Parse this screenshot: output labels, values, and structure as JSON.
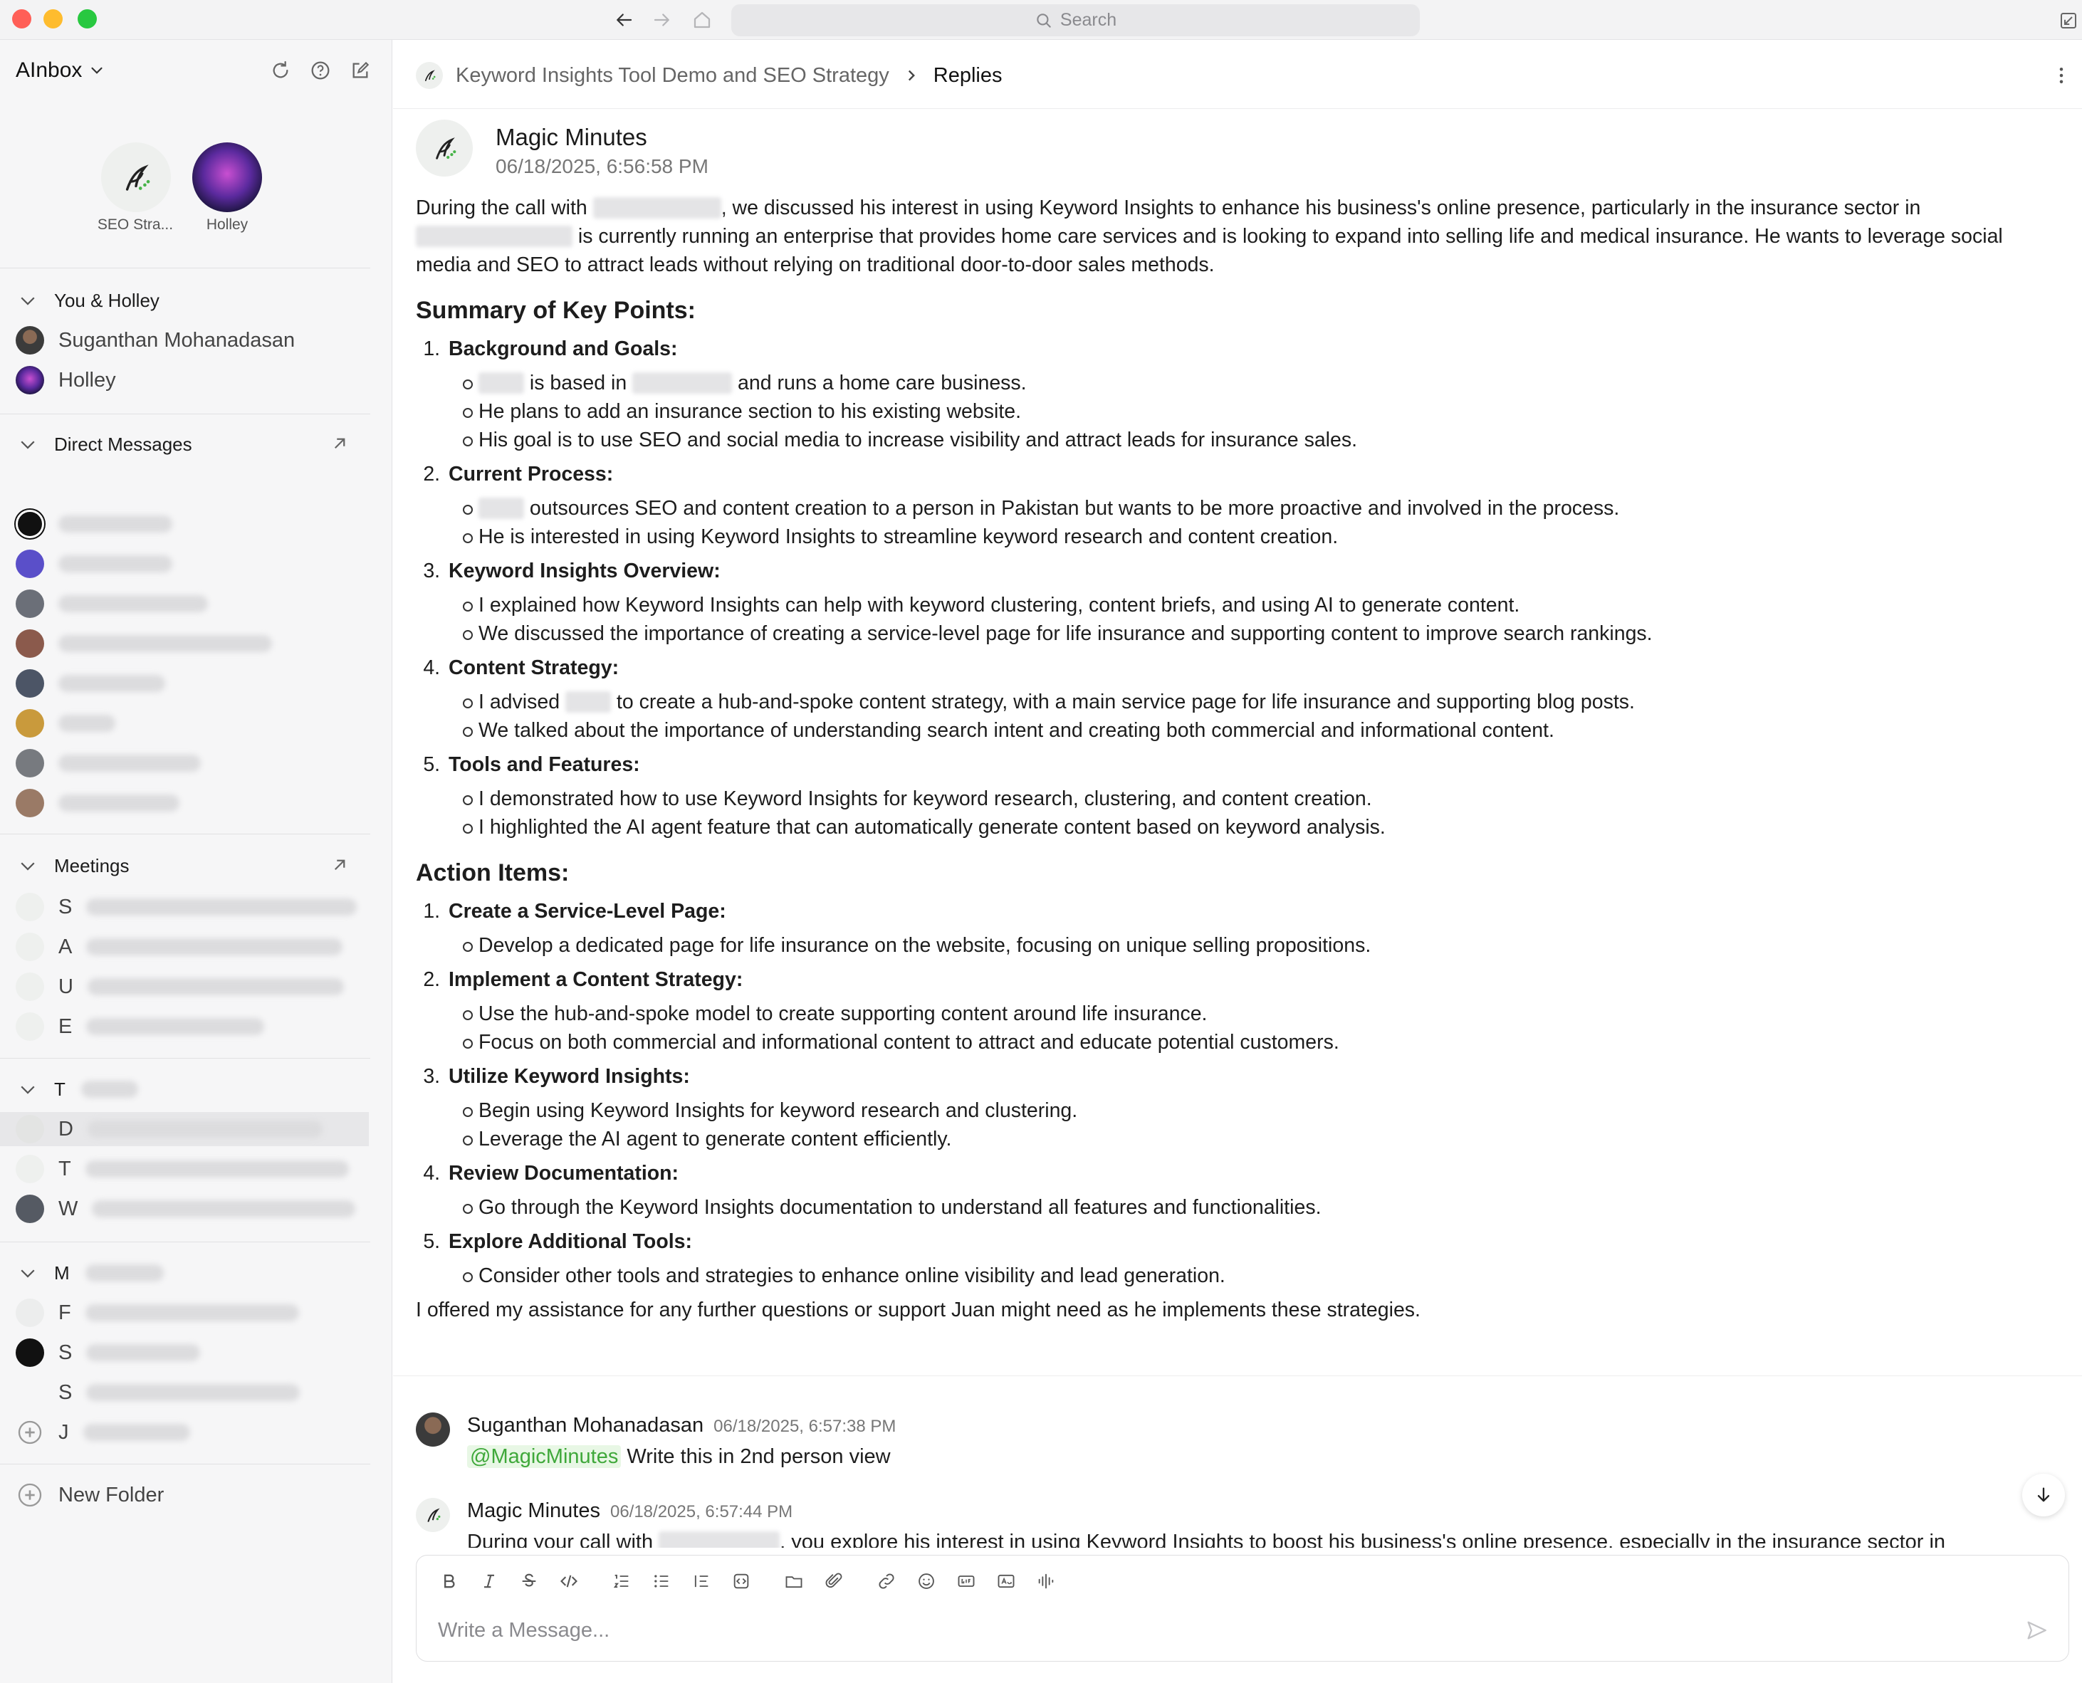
{
  "titlebar": {
    "search_placeholder": "Search"
  },
  "sidebar": {
    "title": "AInbox",
    "pinned": [
      {
        "label": "SEO Stra...",
        "color": "#eef0ee"
      },
      {
        "label": "Holley",
        "color": "#2a1a5e"
      }
    ],
    "you_holley": {
      "header": "You & Holley",
      "items": [
        "Suganthan Mohanadasan",
        "Holley"
      ]
    },
    "direct_messages": {
      "header": "Direct Messages"
    },
    "meetings": {
      "header": "Meetings",
      "items": [
        "S",
        "A",
        "U",
        "E"
      ]
    },
    "threads": {
      "header": "T",
      "items": [
        "D",
        "T",
        "W"
      ]
    },
    "more": {
      "header": "M",
      "items": [
        "F",
        "S",
        "S",
        "J"
      ]
    },
    "new_folder_label": "New Folder"
  },
  "main": {
    "breadcrumb": {
      "root": "Keyword Insights Tool Demo and SEO Strategy",
      "current": "Replies"
    },
    "post": {
      "author": "Magic Minutes",
      "date": "06/18/2025, 6:56:58 PM",
      "intro_a": "During the call with",
      "intro_b": ", we discussed his interest in using Keyword Insights to enhance his business's online presence, particularly in the insurance sector in",
      "intro_c": "is currently running an enterprise that provides home care services and is looking to expand into selling life and medical insurance. He wants to leverage social media and SEO to attract leads without relying on traditional door-to-door sales methods.",
      "summary_heading": "Summary of Key Points:",
      "summary": [
        {
          "title": "Background and Goals:",
          "bullets": [
            [
              "",
              "is based in",
              "and runs a home care business."
            ],
            [
              "He plans to add an insurance section to his existing website."
            ],
            [
              "His goal is to use SEO and social media to increase visibility and attract leads for insurance sales."
            ]
          ]
        },
        {
          "title": "Current Process:",
          "bullets": [
            [
              "",
              "outsources SEO and content creation to a person in Pakistan but wants to be more proactive and involved in the process."
            ],
            [
              "He is interested in using Keyword Insights to streamline keyword research and content creation."
            ]
          ]
        },
        {
          "title": "Keyword Insights Overview:",
          "bullets": [
            [
              "I explained how Keyword Insights can help with keyword clustering, content briefs, and using AI to generate content."
            ],
            [
              "We discussed the importance of creating a service-level page for life insurance and supporting content to improve search rankings."
            ]
          ]
        },
        {
          "title": "Content Strategy:",
          "bullets": [
            [
              "I advised",
              "to create a hub-and-spoke content strategy, with a main service page for life insurance and supporting blog posts."
            ],
            [
              "We talked about the importance of understanding search intent and creating both commercial and informational content."
            ]
          ]
        },
        {
          "title": "Tools and Features:",
          "bullets": [
            [
              "I demonstrated how to use Keyword Insights for keyword research, clustering, and content creation."
            ],
            [
              "I highlighted the AI agent feature that can automatically generate content based on keyword analysis."
            ]
          ]
        }
      ],
      "action_heading": "Action Items:",
      "actions": [
        {
          "title": "Create a Service-Level Page:",
          "bullets": [
            "Develop a dedicated page for life insurance on the website, focusing on unique selling propositions."
          ]
        },
        {
          "title": "Implement a Content Strategy:",
          "bullets": [
            "Use the hub-and-spoke model to create supporting content around life insurance.",
            "Focus on both commercial and informational content to attract and educate potential customers."
          ]
        },
        {
          "title": "Utilize Keyword Insights:",
          "bullets": [
            "Begin using Keyword Insights for keyword research and clustering.",
            "Leverage the AI agent to generate content efficiently."
          ]
        },
        {
          "title": "Review Documentation:",
          "bullets": [
            "Go through the Keyword Insights documentation to understand all features and functionalities."
          ]
        },
        {
          "title": "Explore Additional Tools:",
          "bullets": [
            "Consider other tools and strategies to enhance online visibility and lead generation."
          ]
        }
      ],
      "closing": "I offered my assistance for any further questions or support Juan might need as he implements these strategies."
    },
    "replies": [
      {
        "author": "Suganthan Mohanadasan",
        "time": "06/18/2025, 6:57:38 PM",
        "mention": "@MagicMinutes",
        "text": "Write this in 2nd person view"
      },
      {
        "author": "Magic Minutes",
        "time": "06/18/2025, 6:57:44 PM",
        "text_a": "During your call with",
        "text_b": ", you explore his interest in using Keyword Insights to boost his business's online presence, especially in the insurance sector in"
      }
    ],
    "composer": {
      "placeholder": "Write a Message..."
    }
  },
  "colors": {
    "accent_green": "#3fa83a",
    "mention_bg": "#e8f7e5",
    "sidebar_bg": "#f6f6f7"
  }
}
